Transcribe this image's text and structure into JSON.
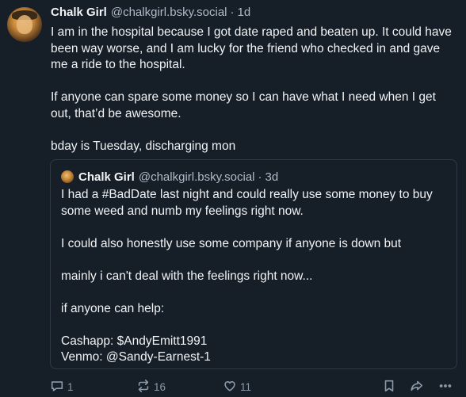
{
  "post": {
    "author_name": "Chalk Girl",
    "author_handle": "@chalkgirl.bsky.social",
    "separator": "·",
    "time": "1d",
    "paragraphs": [
      "I am in the hospital because I got date raped and beaten up. It could have been way worse, and I am lucky for the friend who checked in and gave me a ride to the hospital.",
      "If anyone can spare some money so I can have what I need when I get out, that’d be awesome.",
      "bday is Tuesday, discharging mon"
    ]
  },
  "quote": {
    "author_name": "Chalk Girl",
    "author_handle": "@chalkgirl.bsky.social",
    "separator": "·",
    "time": "3d",
    "paragraphs": [
      "I had a #BadDate last night and could really use some money to buy some weed and numb my feelings right now.",
      "I could also honestly use some company if anyone is down but",
      "mainly i can't deal with the feelings right now...",
      "if anyone can help:",
      "Cashapp: $AndyEmitt1991",
      "Venmo: @Sandy-Earnest-1"
    ]
  },
  "actions": {
    "reply_count": "1",
    "repost_count": "16",
    "like_count": "11",
    "icons": [
      "reply-icon",
      "repost-icon",
      "like-icon",
      "bookmark-icon",
      "share-icon",
      "more-icon"
    ]
  }
}
